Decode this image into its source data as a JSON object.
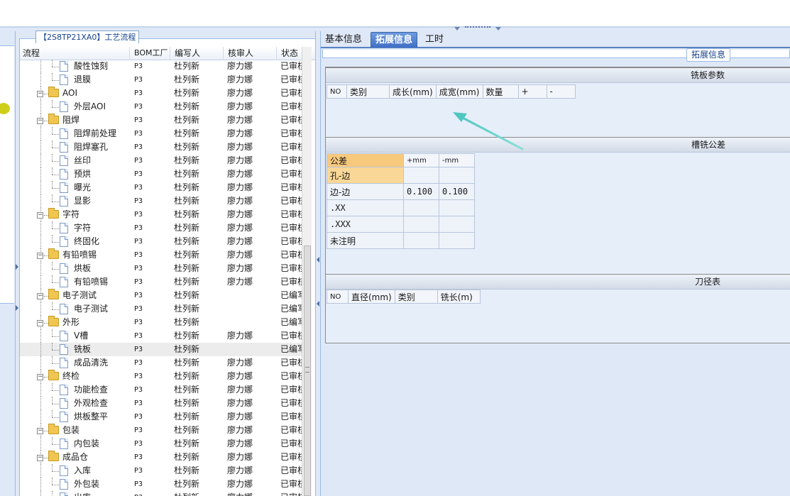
{
  "process_panel": {
    "title": "【2S8TP21XA0】工艺流程",
    "columns": [
      "流程",
      "BOM工厂",
      "编写人",
      "核审人",
      "状态"
    ],
    "rows": [
      {
        "name": "酸性蚀刻",
        "level": 2,
        "type": "doc",
        "bom": "P3",
        "author": "杜列新",
        "reviewer": "廖力娜",
        "status": "已审核"
      },
      {
        "name": "退膜",
        "level": 2,
        "type": "doc",
        "bom": "P3",
        "author": "杜列新",
        "reviewer": "廖力娜",
        "status": "已审核"
      },
      {
        "name": "AOI",
        "level": 1,
        "type": "folder",
        "bom": "P3",
        "author": "杜列新",
        "reviewer": "廖力娜",
        "status": "已审核"
      },
      {
        "name": "外层AOI",
        "level": 2,
        "type": "doc",
        "bom": "P3",
        "author": "杜列新",
        "reviewer": "廖力娜",
        "status": "已审核"
      },
      {
        "name": "阻焊",
        "level": 1,
        "type": "folder",
        "bom": "P3",
        "author": "杜列新",
        "reviewer": "廖力娜",
        "status": "已审核"
      },
      {
        "name": "阻焊前处理",
        "level": 2,
        "type": "doc",
        "bom": "P3",
        "author": "杜列新",
        "reviewer": "廖力娜",
        "status": "已审核"
      },
      {
        "name": "阻焊塞孔",
        "level": 2,
        "type": "doc",
        "bom": "P3",
        "author": "杜列新",
        "reviewer": "廖力娜",
        "status": "已审核"
      },
      {
        "name": "丝印",
        "level": 2,
        "type": "doc",
        "bom": "P3",
        "author": "杜列新",
        "reviewer": "廖力娜",
        "status": "已审核"
      },
      {
        "name": "预烘",
        "level": 2,
        "type": "doc",
        "bom": "P3",
        "author": "杜列新",
        "reviewer": "廖力娜",
        "status": "已审核"
      },
      {
        "name": "曝光",
        "level": 2,
        "type": "doc",
        "bom": "P3",
        "author": "杜列新",
        "reviewer": "廖力娜",
        "status": "已审核"
      },
      {
        "name": "显影",
        "level": 2,
        "type": "doc",
        "bom": "P3",
        "author": "杜列新",
        "reviewer": "廖力娜",
        "status": "已审核"
      },
      {
        "name": "字符",
        "level": 1,
        "type": "folder",
        "bom": "P3",
        "author": "杜列新",
        "reviewer": "廖力娜",
        "status": "已审核"
      },
      {
        "name": "字符",
        "level": 2,
        "type": "doc",
        "bom": "P3",
        "author": "杜列新",
        "reviewer": "廖力娜",
        "status": "已审核"
      },
      {
        "name": "终固化",
        "level": 2,
        "type": "doc",
        "bom": "P3",
        "author": "杜列新",
        "reviewer": "廖力娜",
        "status": "已审核"
      },
      {
        "name": "有铅喷锡",
        "level": 1,
        "type": "folder",
        "bom": "P3",
        "author": "杜列新",
        "reviewer": "廖力娜",
        "status": "已审核"
      },
      {
        "name": "烘板",
        "level": 2,
        "type": "doc",
        "bom": "P3",
        "author": "杜列新",
        "reviewer": "廖力娜",
        "status": "已审核"
      },
      {
        "name": "有铅喷锡",
        "level": 2,
        "type": "doc",
        "bom": "P3",
        "author": "杜列新",
        "reviewer": "廖力娜",
        "status": "已审核"
      },
      {
        "name": "电子测试",
        "level": 1,
        "type": "folder",
        "bom": "P3",
        "author": "杜列新",
        "reviewer": "",
        "status": "已编写"
      },
      {
        "name": "电子测试",
        "level": 2,
        "type": "doc",
        "bom": "P3",
        "author": "杜列新",
        "reviewer": "",
        "status": "已编写"
      },
      {
        "name": "外形",
        "level": 1,
        "type": "folder",
        "bom": "P3",
        "author": "杜列新",
        "reviewer": "",
        "status": "已编写"
      },
      {
        "name": "V槽",
        "level": 2,
        "type": "doc",
        "bom": "P3",
        "author": "杜列新",
        "reviewer": "廖力娜",
        "status": "已审核"
      },
      {
        "name": "铣板",
        "level": 2,
        "type": "doc",
        "bom": "P3",
        "author": "杜列新",
        "reviewer": "",
        "status": "已编写",
        "selected": true
      },
      {
        "name": "成品清洗",
        "level": 2,
        "type": "doc",
        "bom": "P3",
        "author": "杜列新",
        "reviewer": "廖力娜",
        "status": "已审核"
      },
      {
        "name": "终检",
        "level": 1,
        "type": "folder",
        "bom": "P3",
        "author": "杜列新",
        "reviewer": "廖力娜",
        "status": "已审核"
      },
      {
        "name": "功能检查",
        "level": 2,
        "type": "doc",
        "bom": "P3",
        "author": "杜列新",
        "reviewer": "廖力娜",
        "status": "已审核"
      },
      {
        "name": "外观检查",
        "level": 2,
        "type": "doc",
        "bom": "P3",
        "author": "杜列新",
        "reviewer": "廖力娜",
        "status": "已审核"
      },
      {
        "name": "烘板整平",
        "level": 2,
        "type": "doc",
        "bom": "P3",
        "author": "杜列新",
        "reviewer": "廖力娜",
        "status": "已审核"
      },
      {
        "name": "包装",
        "level": 1,
        "type": "folder",
        "bom": "P3",
        "author": "杜列新",
        "reviewer": "廖力娜",
        "status": "已审核"
      },
      {
        "name": "内包装",
        "level": 2,
        "type": "doc",
        "bom": "P3",
        "author": "杜列新",
        "reviewer": "廖力娜",
        "status": "已审核"
      },
      {
        "name": "成品仓",
        "level": 1,
        "type": "folder",
        "bom": "P3",
        "author": "杜列新",
        "reviewer": "廖力娜",
        "status": "已审核"
      },
      {
        "name": "入库",
        "level": 2,
        "type": "doc",
        "bom": "P3",
        "author": "杜列新",
        "reviewer": "廖力娜",
        "status": "已审核"
      },
      {
        "name": "外包装",
        "level": 2,
        "type": "doc",
        "bom": "P3",
        "author": "杜列新",
        "reviewer": "廖力娜",
        "status": "已审核"
      },
      {
        "name": "出库",
        "level": 2,
        "type": "doc",
        "bom": "P3",
        "author": "杜列新",
        "reviewer": "廖力娜",
        "status": "已审核"
      }
    ]
  },
  "tabs": [
    "基本信息",
    "拓展信息",
    "工时"
  ],
  "active_tab": "拓展信息",
  "subtab": "拓展信息",
  "milling_params": {
    "title": "铣板参数",
    "columns": [
      "NO",
      "类别",
      "成长(mm)",
      "成宽(mm)",
      "数量",
      "+",
      "-"
    ]
  },
  "slot_tolerance": {
    "title": "槽铣公差",
    "columns": [
      "公差",
      "+mm",
      "-mm"
    ],
    "rows": [
      {
        "label": "孔-边",
        "plus": "",
        "minus": ""
      },
      {
        "label": "边-边",
        "plus": "0.100",
        "minus": "0.100"
      },
      {
        "label": ".XX",
        "plus": "",
        "minus": ""
      },
      {
        "label": ".XXX",
        "plus": "",
        "minus": ""
      },
      {
        "label": "未注明",
        "plus": "",
        "minus": ""
      }
    ]
  },
  "tool_table": {
    "title": "刀径表",
    "columns": [
      "NO",
      "直径(mm)",
      "类别",
      "铣长(m)"
    ]
  },
  "colors": {
    "accent_tab": "#4a78c8",
    "highlight_cell": "#f7c97c",
    "annotation_arrow": "#5fcfc7"
  }
}
